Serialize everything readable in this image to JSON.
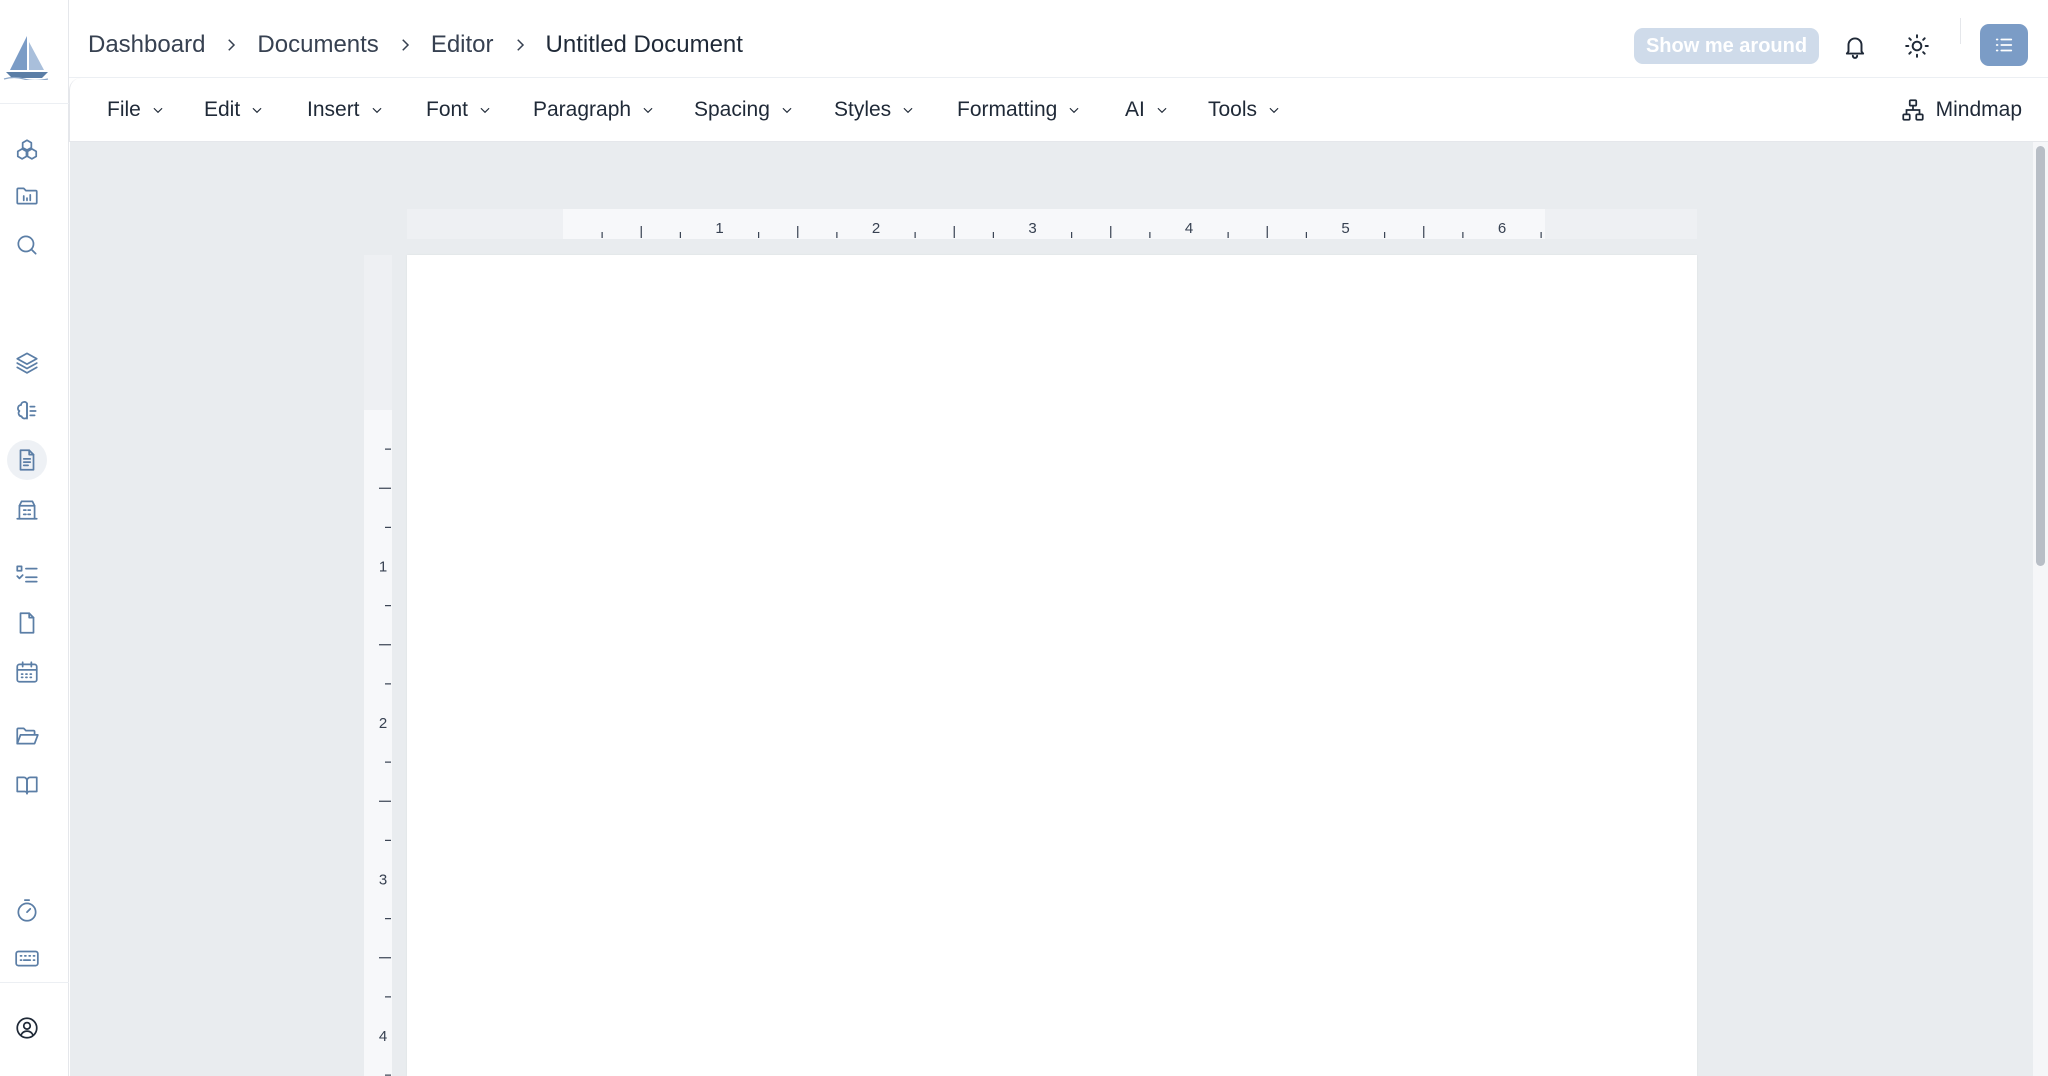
{
  "breadcrumb": {
    "items": [
      "Dashboard",
      "Documents",
      "Editor"
    ],
    "current": "Untitled Document"
  },
  "header": {
    "tour_label": "Show me around",
    "icons": [
      "bell-icon",
      "sun-icon",
      "list-menu-icon"
    ]
  },
  "toolbar": {
    "menus": [
      "File",
      "Edit",
      "Insert",
      "Font",
      "Paragraph",
      "Spacing",
      "Styles",
      "Formatting",
      "AI",
      "Tools"
    ],
    "mindmap_label": "Mindmap"
  },
  "sidebar": {
    "icons": [
      "packages-icon",
      "chart-folder-icon",
      "search-icon",
      "layers-icon",
      "brain-icon",
      "document-icon",
      "building-icon",
      "checklist-icon",
      "file-icon",
      "calendar-icon",
      "folder-open-icon",
      "book-icon",
      "timer-icon",
      "keyboard-icon",
      "user-circle-icon"
    ],
    "active": "document-icon"
  },
  "rulers": {
    "horizontal_labels": [
      "1",
      "2",
      "3",
      "4",
      "5",
      "6"
    ],
    "vertical_labels": [
      "1",
      "2",
      "3",
      "4"
    ]
  },
  "colors": {
    "accent": "#7b9cc6",
    "tour_button": "#cfdbea",
    "workspace_bg": "#e9ecef",
    "sidebar_icon": "#5b7ea6"
  }
}
